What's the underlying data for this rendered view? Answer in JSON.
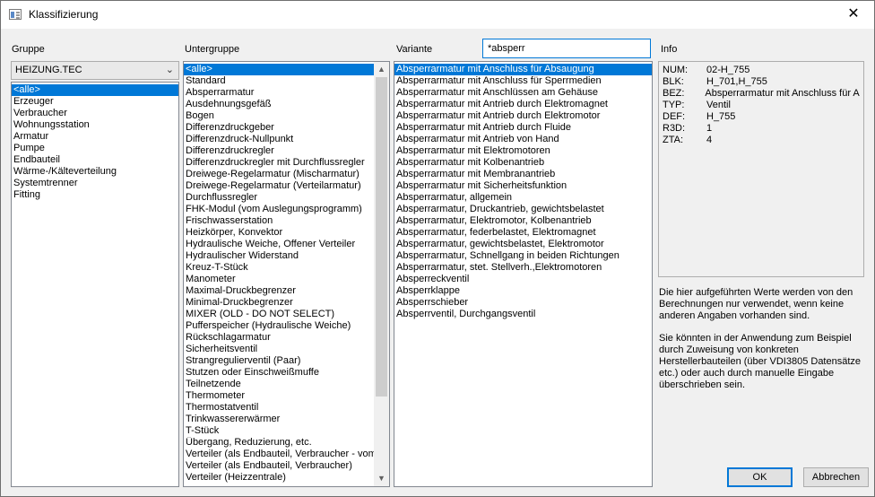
{
  "window": {
    "title": "Klassifizierung",
    "close": "✕"
  },
  "labels": {
    "gruppe": "Gruppe",
    "untergruppe": "Untergruppe",
    "variante": "Variante",
    "info": "Info"
  },
  "gruppe": {
    "selected": "HEIZUNG.TEC",
    "items": [
      "<alle>",
      "Erzeuger",
      "Verbraucher",
      "Wohnungsstation",
      "Armatur",
      "Pumpe",
      "Endbauteil",
      "Wärme-/Kälteverteilung",
      "Systemtrenner",
      "Fitting"
    ]
  },
  "untergruppe": {
    "items": [
      "<alle>",
      " Standard",
      "Absperrarmatur",
      "Ausdehnungsgefäß",
      "Bogen",
      "Differenzdruckgeber",
      "Differenzdruck-Nullpunkt",
      "Differenzdruckregler",
      "Differenzdruckregler mit Durchflussregler",
      "Dreiwege-Regelarmatur (Mischarmatur)",
      "Dreiwege-Regelarmatur (Verteilarmatur)",
      "Durchflussregler",
      "FHK-Modul (vom Auslegungsprogramm)",
      "Frischwasserstation",
      "Heizkörper, Konvektor",
      "Hydraulische Weiche, Offener Verteiler",
      "Hydraulischer Widerstand",
      "Kreuz-T-Stück",
      "Manometer",
      "Maximal-Druckbegrenzer",
      "Minimal-Druckbegrenzer",
      "MIXER (OLD - DO NOT SELECT)",
      "Pufferspeicher (Hydraulische Weiche)",
      "Rückschlagarmatur",
      "Sicherheitsventil",
      "Strangregulierventil (Paar)",
      "Stutzen oder Einschweißmuffe",
      "Teilnetzende",
      "Thermometer",
      "Thermostatventil",
      "Trinkwassererwärmer",
      "T-Stück",
      "Übergang, Reduzierung, etc.",
      "Verteiler (als Endbauteil, Verbraucher - vom",
      "Verteiler (als Endbauteil, Verbraucher)",
      "Verteiler (Heizzentrale)"
    ]
  },
  "variante": {
    "search_value": "*absperr",
    "items": [
      "Absperrarmatur mit Anschluss für Absaugung",
      "Absperrarmatur mit Anschluss für Sperrmedien",
      "Absperrarmatur mit Anschlüssen am Gehäuse",
      "Absperrarmatur mit Antrieb durch Elektromagnet",
      "Absperrarmatur mit Antrieb durch Elektromotor",
      "Absperrarmatur mit Antrieb durch Fluide",
      "Absperrarmatur mit Antrieb von Hand",
      "Absperrarmatur mit Elektromotoren",
      "Absperrarmatur mit Kolbenantrieb",
      "Absperrarmatur mit Membranantrieb",
      "Absperrarmatur mit Sicherheitsfunktion",
      "Absperrarmatur, allgemein",
      "Absperrarmatur, Druckantrieb, gewichtsbelastet",
      "Absperrarmatur, Elektromotor, Kolbenantrieb",
      "Absperrarmatur, federbelastet, Elektromagnet",
      "Absperrarmatur, gewichtsbelastet, Elektromotor",
      "Absperrarmatur, Schnellgang in beiden Richtungen",
      "Absperrarmatur, stet. Stellverh.,Elektromotoren",
      "Absperreckventil",
      "Absperrklappe",
      "Absperrschieber",
      "Absperrventil, Durchgangsventil"
    ]
  },
  "info": {
    "rows": [
      {
        "key": "NUM:",
        "val": "02-H_755"
      },
      {
        "key": "BLK:",
        "val": "H_701,H_755"
      },
      {
        "key": "BEZ:",
        "val": "Absperrarmatur mit Anschluss für Ab"
      },
      {
        "key": "TYP:",
        "val": "Ventil"
      },
      {
        "key": "DEF:",
        "val": "H_755"
      },
      {
        "key": "R3D:",
        "val": "1"
      },
      {
        "key": "ZTA:",
        "val": "4"
      }
    ],
    "note1": "Die hier aufgeführten Werte werden von den Berechnungen nur verwendet, wenn keine anderen Angaben vorhanden sind.",
    "note2": "Sie könnten in der Anwendung zum Beispiel durch Zuweisung von konkreten Herstellerbauteilen (über VDI3805 Datensätze etc.) oder auch durch manuelle Eingabe überschrieben sein."
  },
  "buttons": {
    "ok": "OK",
    "cancel": "Abbrechen"
  }
}
